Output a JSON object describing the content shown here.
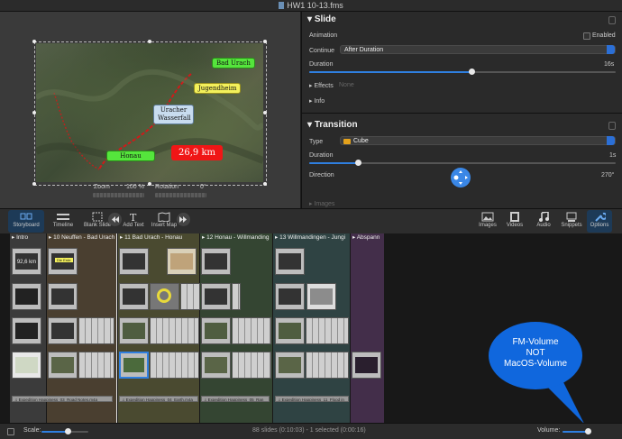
{
  "window": {
    "title": "HW1 10-13.fms"
  },
  "preview": {
    "labels": {
      "bad_urach": "Bad Urach",
      "jugendheim": "Jugendheim",
      "uracher_wasserfall_line1": "Uracher",
      "uracher_wasserfall_line2": "Wasserfall",
      "honau": "Honau",
      "distance": "26,9 km"
    },
    "zoom_label": "Zoom",
    "zoom_value": "100 %",
    "rotation_label": "Rotation",
    "rotation_value": "0°"
  },
  "slide": {
    "heading": "Slide",
    "animation_label": "Animation",
    "enabled_label": "Enabled",
    "enabled_checked": false,
    "continue_label": "Continue",
    "continue_value": "After Duration",
    "duration_label": "Duration",
    "duration_value": "16s",
    "duration_fraction": 0.53,
    "effects_label": "Effects",
    "effects_value": "None",
    "info_label": "Info"
  },
  "transition": {
    "heading": "Transition",
    "type_label": "Type",
    "type_value": "Cube",
    "duration_label": "Duration",
    "duration_value": "1s",
    "duration_fraction": 0.16,
    "direction_label": "Direction",
    "direction_value": "270°",
    "images_label": "Images"
  },
  "toolbar": {
    "storyboard": "Storyboard",
    "timeline": "Timeline",
    "blank_slide": "Blank Slide",
    "add_text": "Add Text",
    "insert_map": "Insert Map",
    "images": "Images",
    "videos": "Videos",
    "audio": "Audio",
    "snippets": "Snippets",
    "options": "Options"
  },
  "timeline": {
    "chapters": [
      {
        "title": "Intro"
      },
      {
        "title": "10 Neuffen - Bad Urach"
      },
      {
        "title": "11 Bad Urach - Honau"
      },
      {
        "title": "12 Honau - Willmanding"
      },
      {
        "title": "13 Willmandingen - Jungi"
      },
      {
        "title": "Abspann"
      }
    ],
    "thumb_texts": {
      "distance": "92,6 km",
      "die_erde": "Die Erde"
    },
    "audio_tracks": [
      "Expedition Happiness_03_Road Notes.m4a",
      "Expedition Happiness_04_Earth.m4a",
      "Expedition Happiness_05_Ran",
      "Expedition Happiness_11_Flood in"
    ]
  },
  "annotation": {
    "line1": "FM-Volume",
    "line2": "NOT",
    "line3": "MacOS-Volume"
  },
  "status": {
    "scale_label": "Scale:",
    "scale_fraction": 0.55,
    "info": "88 slides (0:10:03) - 1 selected (0:00:16)",
    "volume_label": "Volume:",
    "volume_fraction": 0.93
  },
  "colors": {
    "accent": "#2f7fe0",
    "bubble": "#1067dd",
    "label_green": "#55e53c",
    "label_red": "#f01616"
  }
}
